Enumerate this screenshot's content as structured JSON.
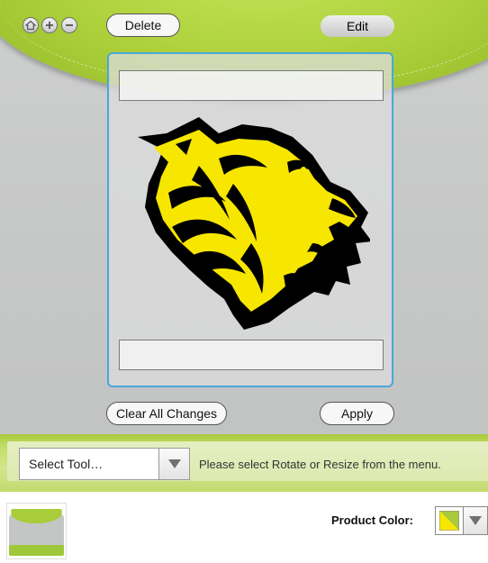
{
  "toolbar_top": {
    "home_icon": "home-icon",
    "zoom_in_icon": "plus-circle-icon",
    "zoom_out_icon": "minus-circle-icon",
    "delete_label": "Delete",
    "edit_label": "Edit"
  },
  "canvas": {
    "artwork": "tiger-head-artwork",
    "artwork_colors": {
      "fill": "#f7e600",
      "outline": "#000000"
    },
    "clear_label": "Clear All Changes",
    "apply_label": "Apply"
  },
  "tool_bar": {
    "select_value": "Select Tool…",
    "hint": "Please select Rotate or Resize from the menu."
  },
  "product": {
    "color_label": "Product Color:",
    "color_swatch": [
      "#f7e600",
      "#a8c93a"
    ]
  },
  "colors": {
    "accent_green": "#acd03a",
    "selection_blue": "#48a8d8"
  }
}
